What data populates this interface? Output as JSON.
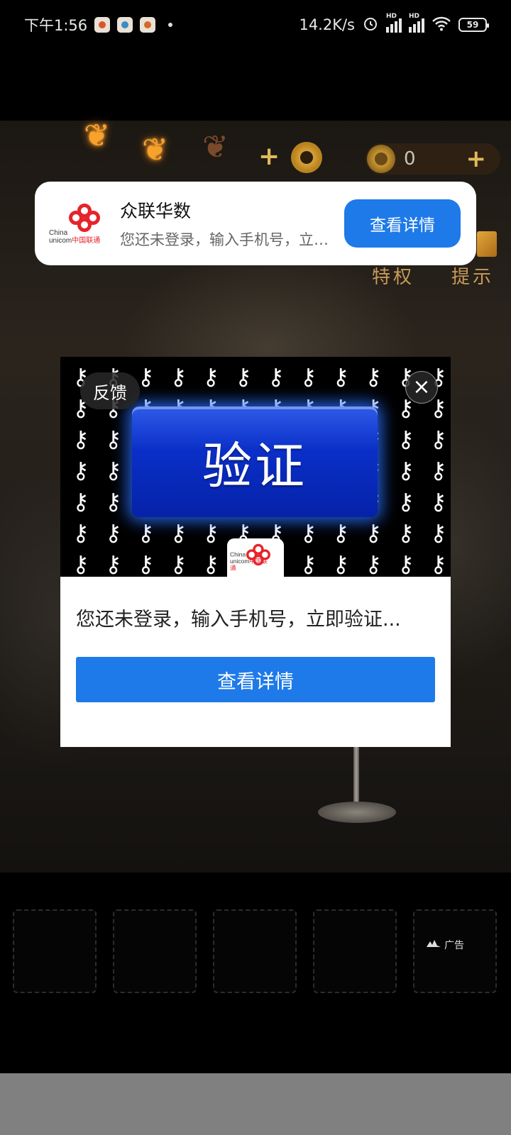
{
  "status_bar": {
    "time": "下午1:56",
    "net_speed": "14.2K/s",
    "signal_tag_1": "HD",
    "signal_tag_2": "HD",
    "battery": "59"
  },
  "game": {
    "coin_count": "0",
    "privilege_label": "特权",
    "hint_label": "提示"
  },
  "notification": {
    "app_name": "众联华数",
    "message": "您还未登录，输入手机号，立即验证...",
    "action_label": "查看详情",
    "logo_text_1": "China",
    "logo_text_2": "unicom",
    "logo_text_3": "中国联通"
  },
  "ad_dialog": {
    "feedback_label": "反馈",
    "close_symbol": "×",
    "banner_button_label": "验证",
    "message": "您还未登录，输入手机号，立即验证...",
    "cta_label": "查看详情",
    "logo_text_1": "China",
    "logo_text_2": "unicom",
    "logo_text_3": "中国联通"
  },
  "ad_badge": {
    "label": "广告"
  },
  "colors": {
    "accent_blue": "#1e7ae8",
    "unicom_red": "#e5242b",
    "verify_blue": "#0a2fc8"
  }
}
